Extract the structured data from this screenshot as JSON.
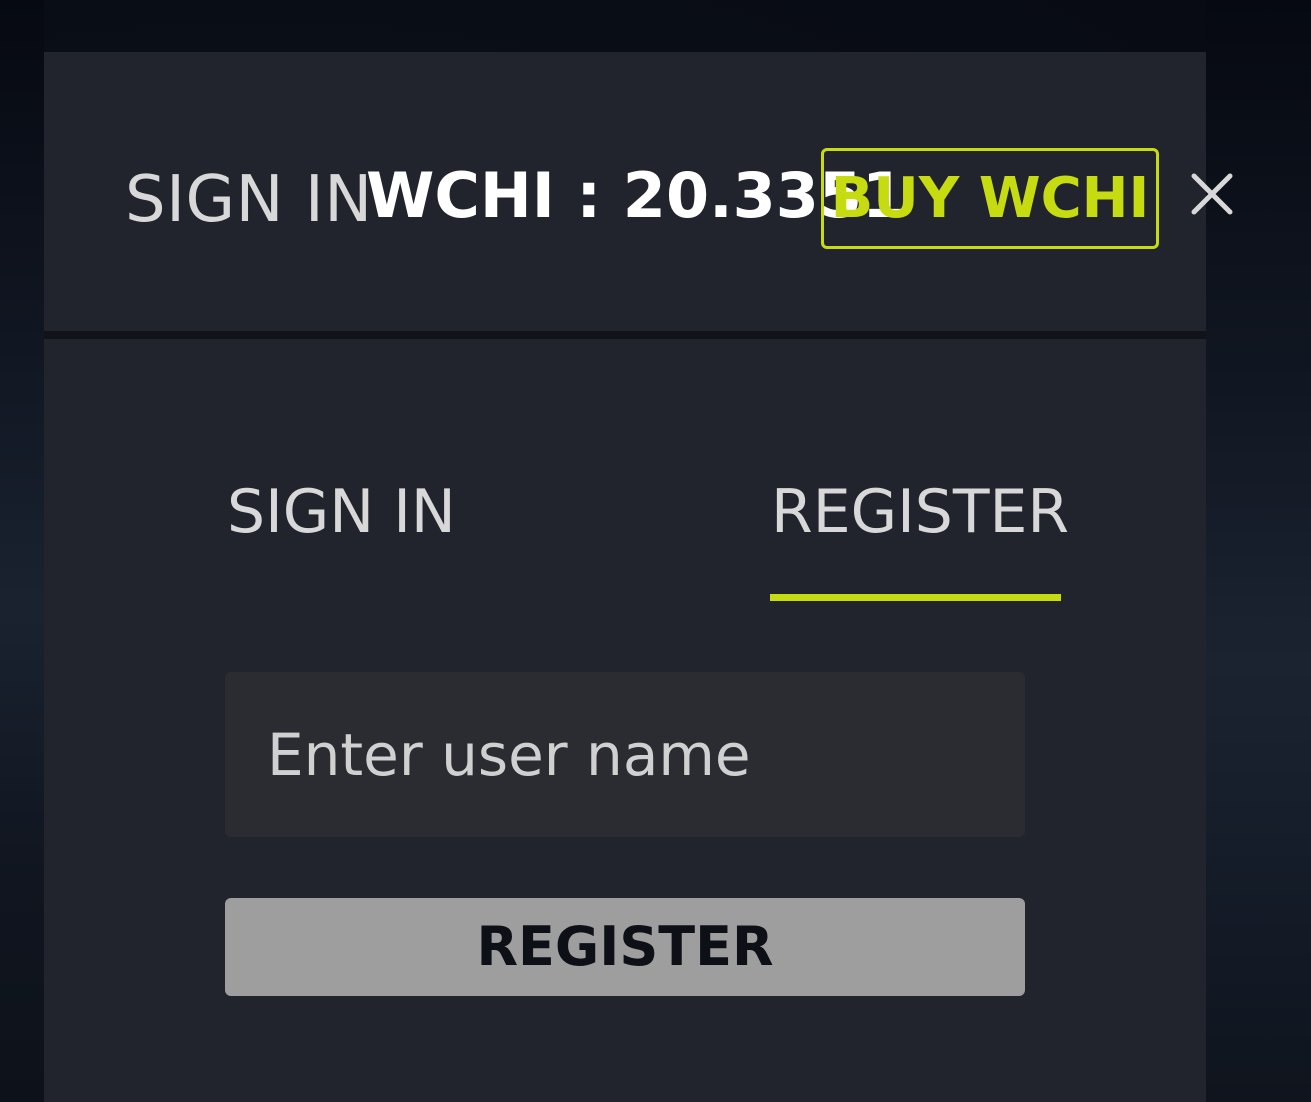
{
  "header": {
    "title": "SIGN IN",
    "balance": "WCHI : 20.3351",
    "buy_label": "BUY WCHI"
  },
  "tabs": {
    "signin": "SIGN IN",
    "register": "REGISTER",
    "active": "register"
  },
  "form": {
    "username_placeholder": "Enter user name",
    "username_value": "",
    "submit_label": "REGISTER"
  },
  "icons": {
    "close": "close-icon"
  },
  "colors": {
    "accent": "#c7dc10",
    "modal_background": "#21242c",
    "input_background": "#2a2c32",
    "button_background": "#9e9e9e"
  }
}
